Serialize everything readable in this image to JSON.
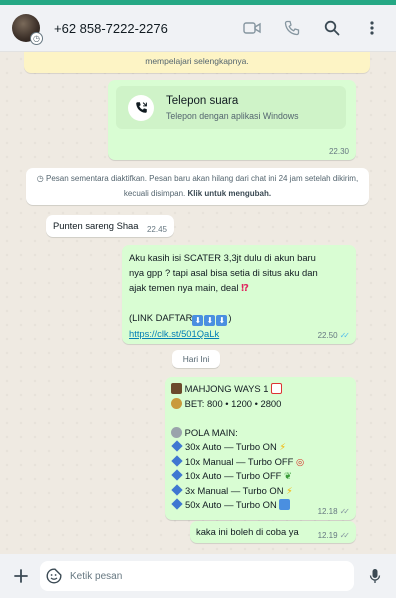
{
  "header": {
    "contact_phone": "+62 858-7222-2276"
  },
  "notice_top": "mempelajari selengkapnya.",
  "call": {
    "title": "Telepon suara",
    "subtitle": "Telepon dengan aplikasi Windows",
    "time": "22.30"
  },
  "system_notice": {
    "text": "Pesan sementara diaktifkan. Pesan baru akan hilang dari chat ini 24 jam setelah dikirim, kecuali disimpan.",
    "link": "Klik untuk mengubah."
  },
  "messages": {
    "m1": {
      "text": "Punten sareng Shaa",
      "time": "22.45"
    },
    "m2": {
      "line1": "Aku kasih isi SCATER 3,3jt dulu di akun baru",
      "line2": "nya gpp ? tapi asal bisa setia di situs aku dan",
      "line3": "ajak temen nya main, deal",
      "link_label": "(LINK DAFTAR",
      "link_close": ")",
      "url": "https://clk.st/501QaLk",
      "time": "22.50"
    },
    "date_chip": "Hari Ini",
    "m3": {
      "title": "MAHJONG WAYS 1",
      "bet": "BET: 800 • 1200 • 2800",
      "pola": "POLA MAIN:",
      "lines": [
        "30x Auto — Turbo ON",
        "10x Manual — Turbo OFF",
        "10x Auto — Turbo OFF",
        "3x Manual — Turbo ON",
        "50x Auto — Turbo ON"
      ],
      "time": "12.18"
    },
    "m4": {
      "text": "kaka ini boleh di coba ya",
      "time": "12.19"
    }
  },
  "composer": {
    "placeholder": "Ketik pesan"
  },
  "colors": {
    "accent": "#25a884",
    "outgoing_bubble": "#d9fdd3",
    "incoming_bubble": "#ffffff",
    "read_tick": "#53bdeb",
    "link": "#027eb5"
  }
}
